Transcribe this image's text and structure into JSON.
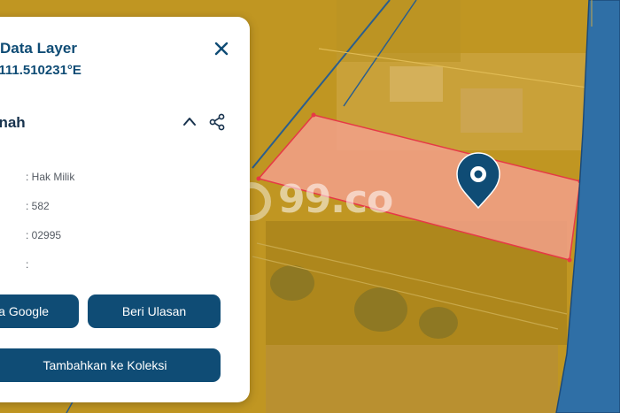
{
  "panel": {
    "title": "Data Layer",
    "coordinates": ", 111.510231°E",
    "section_title": "anah",
    "fields": [
      {
        "value": ": Hak Milik"
      },
      {
        "value": ": 582"
      },
      {
        "value": ": 02995"
      },
      {
        "value": ":"
      }
    ],
    "buttons": {
      "google": "a Google",
      "ulasan": "Beri Ulasan",
      "koleksi": "Tambahkan ke Koleksi"
    }
  },
  "map": {
    "watermark": "99.co"
  },
  "colors": {
    "accent": "#0f4c75",
    "overlay_yellow": "#d4a214",
    "parcel_fill": "#f2a08a",
    "parcel_border": "#e63946",
    "road_blue": "#2f6fa6"
  },
  "icons": {
    "close": "close-icon",
    "collapse": "chevron-up-icon",
    "share": "share-icon",
    "pin": "map-pin-icon"
  }
}
